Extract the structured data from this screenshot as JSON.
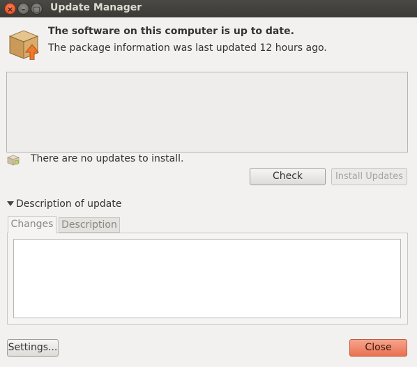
{
  "window": {
    "title": "Update Manager",
    "close_glyph": "×",
    "min_glyph": "–",
    "max_glyph": "□"
  },
  "header": {
    "headline": "The software on this computer is up to date.",
    "subline": "The package information was last updated 12 hours ago.",
    "icon": "package-update-icon"
  },
  "updates_list": {
    "items": []
  },
  "status": {
    "text": "There are no updates to install.",
    "icon": "package-status-icon"
  },
  "actions": {
    "check_label": "Check",
    "install_label": "Install Updates"
  },
  "description": {
    "expander_label": "Description of update",
    "tabs": [
      {
        "label": "Changes",
        "selected": true
      },
      {
        "label": "Description",
        "selected": false
      }
    ],
    "content": ""
  },
  "footer": {
    "settings_label": "Settings...",
    "close_label": "Close"
  },
  "colors": {
    "titlebar": "#3b3a36",
    "close_accent": "#e9714f",
    "window_bg": "#f2f1f0"
  }
}
